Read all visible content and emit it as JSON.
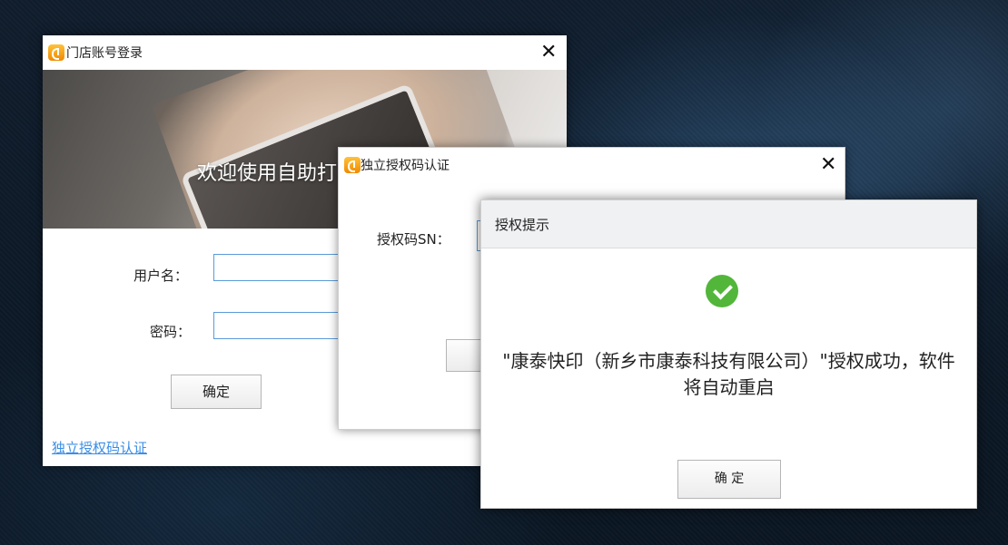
{
  "login_window": {
    "title": "门店账号登录",
    "close_glyph": "✕",
    "banner_text": "欢迎使用自助打印软件",
    "username_label": "用户名：",
    "password_label": "密码：",
    "username_value": "",
    "password_value": "",
    "confirm_label": "确定",
    "sn_link": "独立授权码认证"
  },
  "sn_window": {
    "title": "独立授权码认证",
    "close_glyph": "✕",
    "sn_label": "授权码SN："
  },
  "auth_dialog": {
    "title": "授权提示",
    "icon": "check-circle-icon",
    "message": "\"康泰快印（新乡市康泰科技有限公司）\"授权成功，软件将自动重启",
    "confirm_label": "确 定"
  },
  "colors": {
    "link": "#3a8ee6",
    "success": "#52b63a",
    "input_border": "#5a9bd8"
  }
}
